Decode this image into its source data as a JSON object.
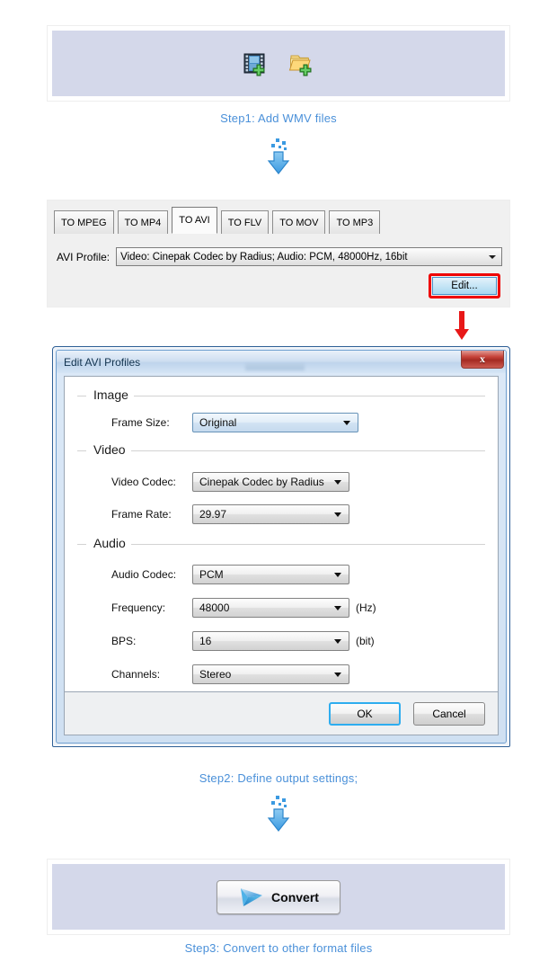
{
  "theme": {
    "panel_band": "#d4d8ea",
    "step_text": "#4a90d9",
    "highlight_red": "#ef0000",
    "dialog_blue": "#2e5f96"
  },
  "step1": {
    "caption": "Step1: Add WMV files",
    "add_video_icon": "add-video-file-icon",
    "add_folder_icon": "add-folder-icon",
    "arrow_icon": "blue-down-arrow-icon"
  },
  "step2": {
    "caption": "Step2: Define output settings;",
    "arrow_icon": "blue-down-arrow-icon",
    "tabs": [
      {
        "label": "TO MPEG",
        "active": false
      },
      {
        "label": "TO MP4",
        "active": false
      },
      {
        "label": "TO AVI",
        "active": true
      },
      {
        "label": "TO FLV",
        "active": false
      },
      {
        "label": "TO MOV",
        "active": false
      },
      {
        "label": "TO MP3",
        "active": false
      }
    ],
    "profile_label": "AVI Profile:",
    "profile_value": "Video: Cinepak Codec by Radius; Audio: PCM, 48000Hz, 16bit",
    "edit_button": "Edit...",
    "red_arrow_icon": "red-down-arrow-icon"
  },
  "dialog": {
    "title": "Edit AVI Profiles",
    "close_icon": "close-icon",
    "close_glyph": "x",
    "groups": [
      {
        "title": "Image",
        "fields": [
          {
            "label": "Frame Size:",
            "value": "Original",
            "unit": "",
            "focused": true
          }
        ]
      },
      {
        "title": "Video",
        "fields": [
          {
            "label": "Video Codec:",
            "value": "Cinepak Codec by Radius",
            "unit": "",
            "focused": false
          },
          {
            "label": "Frame Rate:",
            "value": "29.97",
            "unit": "",
            "focused": false
          }
        ]
      },
      {
        "title": "Audio",
        "fields": [
          {
            "label": "Audio Codec:",
            "value": "PCM",
            "unit": "",
            "focused": false
          },
          {
            "label": "Frequency:",
            "value": "48000",
            "unit": "(Hz)",
            "focused": false
          },
          {
            "label": "BPS:",
            "value": "16",
            "unit": "(bit)",
            "focused": false
          },
          {
            "label": "Channels:",
            "value": "Stereo",
            "unit": "",
            "focused": false
          }
        ]
      }
    ],
    "ok_button": "OK",
    "cancel_button": "Cancel"
  },
  "step3": {
    "caption": "Step3: Convert to other format files",
    "convert_button": "Convert",
    "convert_icon": "play-arrow-icon"
  }
}
